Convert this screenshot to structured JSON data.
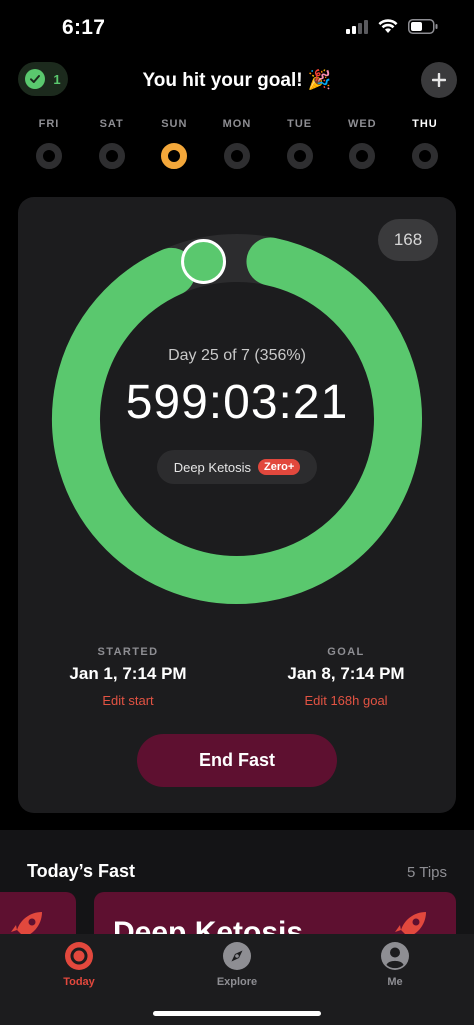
{
  "status_bar": {
    "time": "6:17"
  },
  "header": {
    "streak_count": "1",
    "title": "You hit your goal! 🎉",
    "add_label": "+"
  },
  "week": [
    {
      "label": "FRI",
      "state": "empty"
    },
    {
      "label": "SAT",
      "state": "empty"
    },
    {
      "label": "SUN",
      "state": "done"
    },
    {
      "label": "MON",
      "state": "empty"
    },
    {
      "label": "TUE",
      "state": "empty"
    },
    {
      "label": "WED",
      "state": "empty"
    },
    {
      "label": "THU",
      "state": "today"
    }
  ],
  "timer_card": {
    "goal_hours": "168",
    "day_progress": "Day 25 of 7 (356%)",
    "elapsed": "599:03:21",
    "zone_label": "Deep Ketosis",
    "zone_tag": "Zero+",
    "progress_fraction": 1.0,
    "started": {
      "heading": "STARTED",
      "value": "Jan 1, 7:14 PM",
      "edit": "Edit start"
    },
    "goal": {
      "heading": "GOAL",
      "value": "Jan 8, 7:14 PM",
      "edit": "Edit 168h goal"
    },
    "end_button": "End Fast"
  },
  "todays_fast": {
    "title": "Today’s Fast",
    "tips": "5 Tips",
    "card_title": "Deep Ketosis"
  },
  "tab_bar": {
    "tabs": [
      {
        "label": "Today",
        "active": true
      },
      {
        "label": "Explore",
        "active": false
      },
      {
        "label": "Me",
        "active": false
      }
    ]
  },
  "colors": {
    "ring_green": "#5ac86e",
    "streak_green": "#5ac86e",
    "done_orange": "#f3a73a",
    "accent_red": "#e2483d",
    "end_button": "#5e1030"
  }
}
